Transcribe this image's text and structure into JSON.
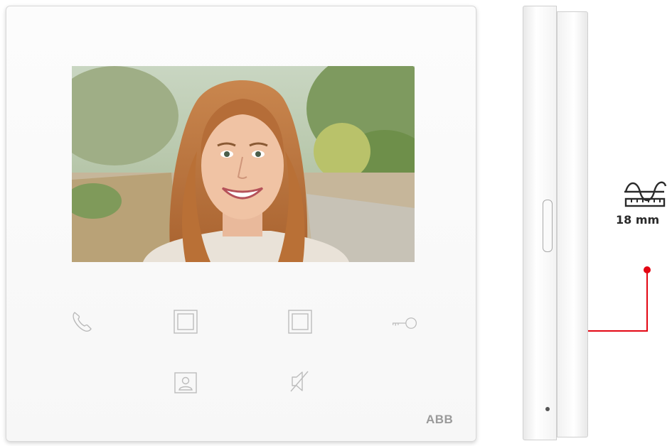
{
  "front_panel": {
    "brand_logo": "ABB",
    "buttons": [
      {
        "name": "call-button",
        "icon": "phone-handset-icon"
      },
      {
        "name": "soft-button-1",
        "icon": "square-outline-icon"
      },
      {
        "name": "soft-button-2",
        "icon": "square-outline-icon"
      },
      {
        "name": "door-unlock-button",
        "icon": "key-icon"
      },
      {
        "name": "camera-view-button",
        "icon": "portrait-frame-icon"
      },
      {
        "name": "mute-button",
        "icon": "speaker-muted-icon"
      }
    ],
    "screen": {
      "content": "video-feed-photo"
    }
  },
  "depth_callout": {
    "icon": "depth-wave-ruler-icon",
    "value": "18 mm",
    "accent_color": "#e30613"
  }
}
